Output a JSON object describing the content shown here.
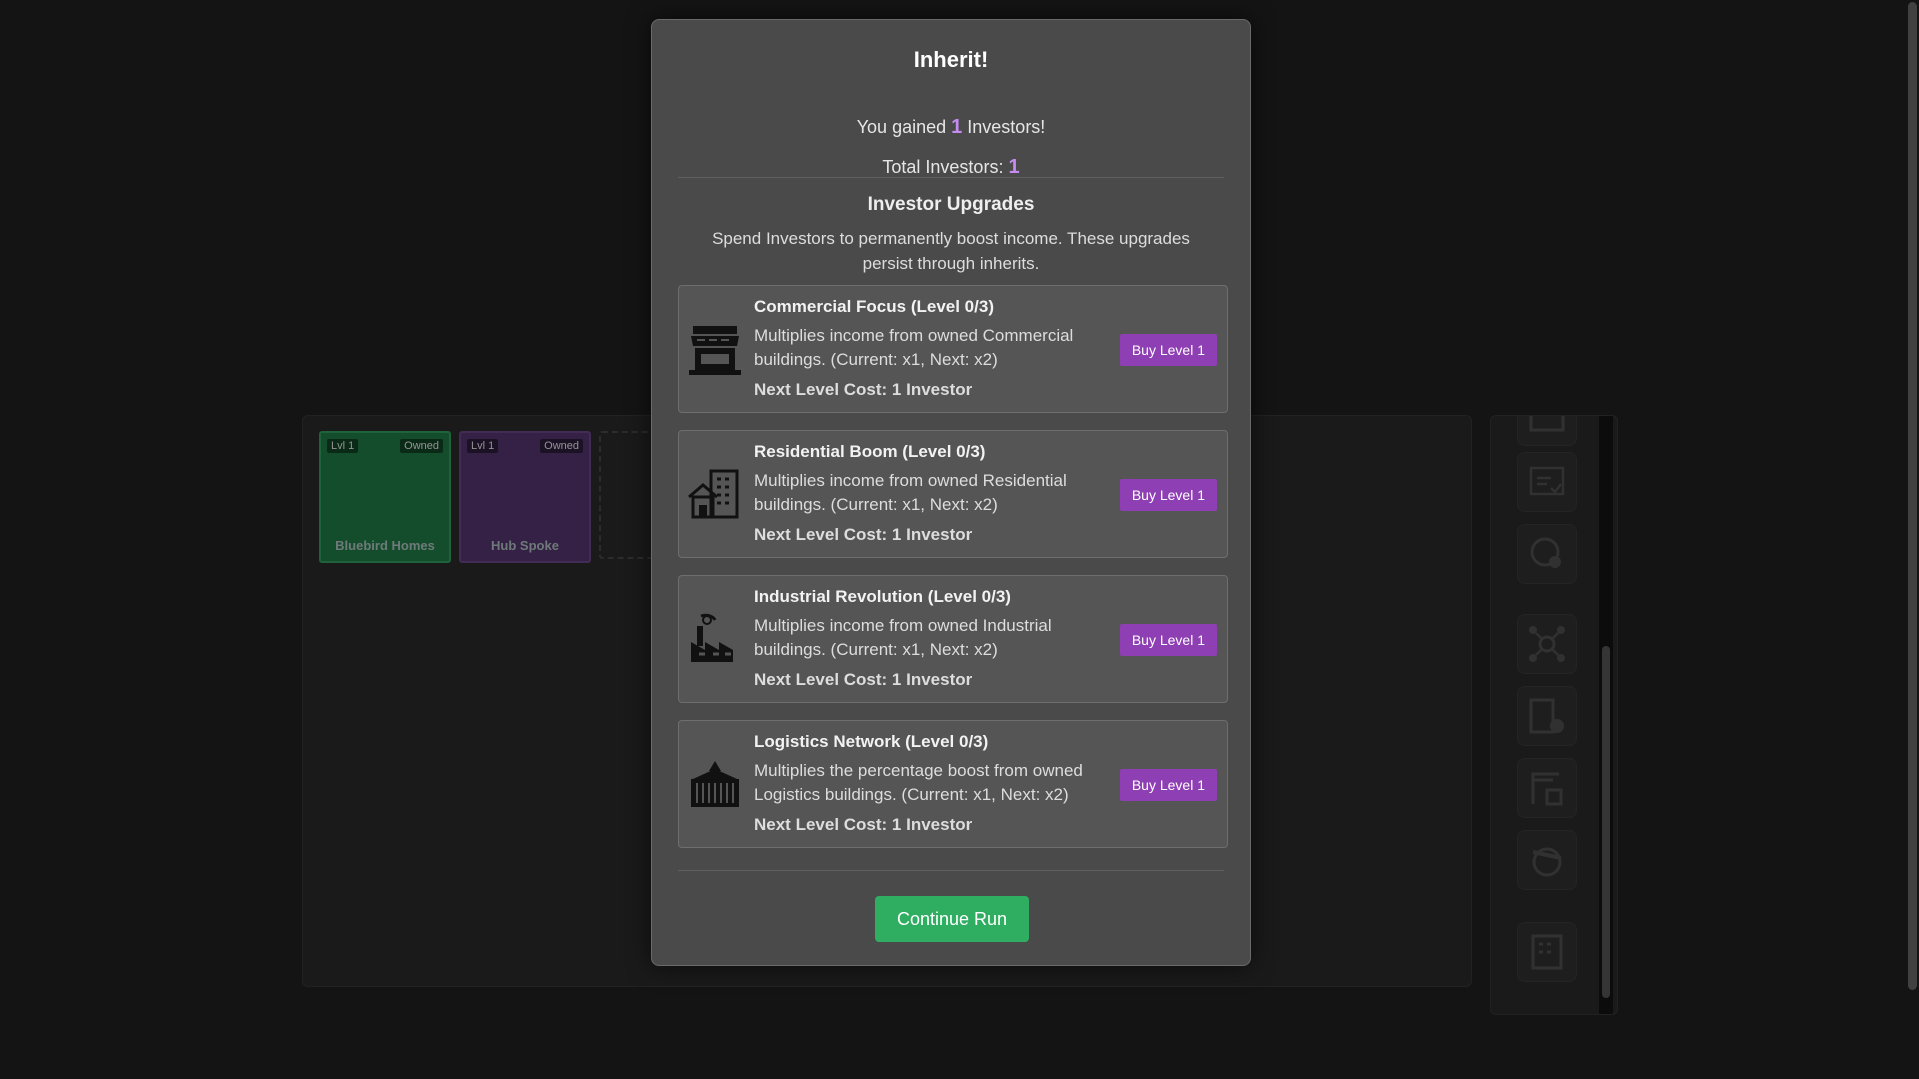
{
  "board": {
    "tiles": [
      {
        "level": "Lvl 1",
        "status": "Owned",
        "name": "Bluebird Homes"
      },
      {
        "level": "Lvl 1",
        "status": "Owned",
        "name": "Hub Spoke"
      }
    ]
  },
  "sidebar_icons": [
    "tax-icon",
    "globe-network-icon",
    "network-hub-icon",
    "building-add-icon",
    "construction-crane-icon",
    "globe-plane-icon",
    "office-building-icon"
  ],
  "modal": {
    "title": "Inherit!",
    "gained_prefix": "You gained",
    "gained_value": "1",
    "gained_suffix": "Investors!",
    "total_label": "Total Investors:",
    "total_value": "1",
    "upgrades_title": "Investor Upgrades",
    "upgrades_desc": "Spend Investors to permanently boost income. These upgrades persist through inherits.",
    "upgrades": [
      {
        "icon": "storefront-icon",
        "title": "Commercial Focus (Level 0/3)",
        "desc": "Multiplies income from owned Commercial buildings. (Current: x1, Next: x2)",
        "cost": "Next Level Cost: 1 Investor",
        "button": "Buy Level 1"
      },
      {
        "icon": "residential-building-icon",
        "title": "Residential Boom (Level 0/3)",
        "desc": "Multiplies income from owned Residential buildings. (Current: x1, Next: x2)",
        "cost": "Next Level Cost: 1 Investor",
        "button": "Buy Level 1"
      },
      {
        "icon": "factory-icon",
        "title": "Industrial Revolution (Level 0/3)",
        "desc": "Multiplies income from owned Industrial buildings. (Current: x1, Next: x2)",
        "cost": "Next Level Cost: 1 Investor",
        "button": "Buy Level 1"
      },
      {
        "icon": "shipping-container-icon",
        "title": "Logistics Network (Level 0/3)",
        "desc": "Multiplies the percentage boost from owned Logistics buildings. (Current: x1, Next: x2)",
        "cost": "Next Level Cost: 1 Investor",
        "button": "Buy Level 1"
      }
    ],
    "continue_label": "Continue Run"
  },
  "colors": {
    "accent_purple": "#8e3fb3",
    "continue_green": "#2fae62",
    "investor_number": "#c58bf0"
  }
}
